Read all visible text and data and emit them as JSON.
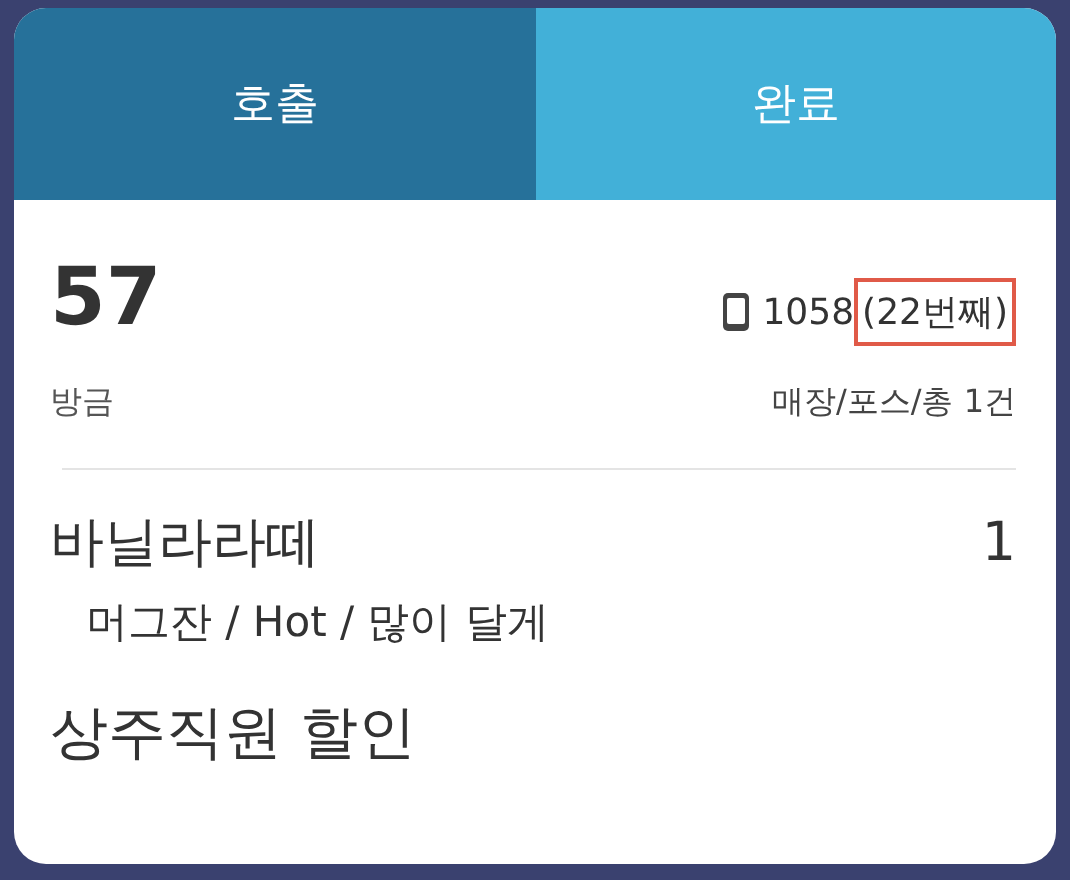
{
  "tabs": [
    {
      "label": "호출",
      "selected": true
    },
    {
      "label": "완료",
      "selected": false
    }
  ],
  "order": {
    "number": "57",
    "phone": "1058",
    "rank": "(22번째)",
    "rank_highlighted": true,
    "time": "방금",
    "source": "매장/포스/총 1건"
  },
  "items": [
    {
      "name": "바닐라라떼",
      "quantity": "1",
      "options": "머그잔 / Hot / 많이 달게"
    }
  ],
  "discount": "상주직원 할인"
}
